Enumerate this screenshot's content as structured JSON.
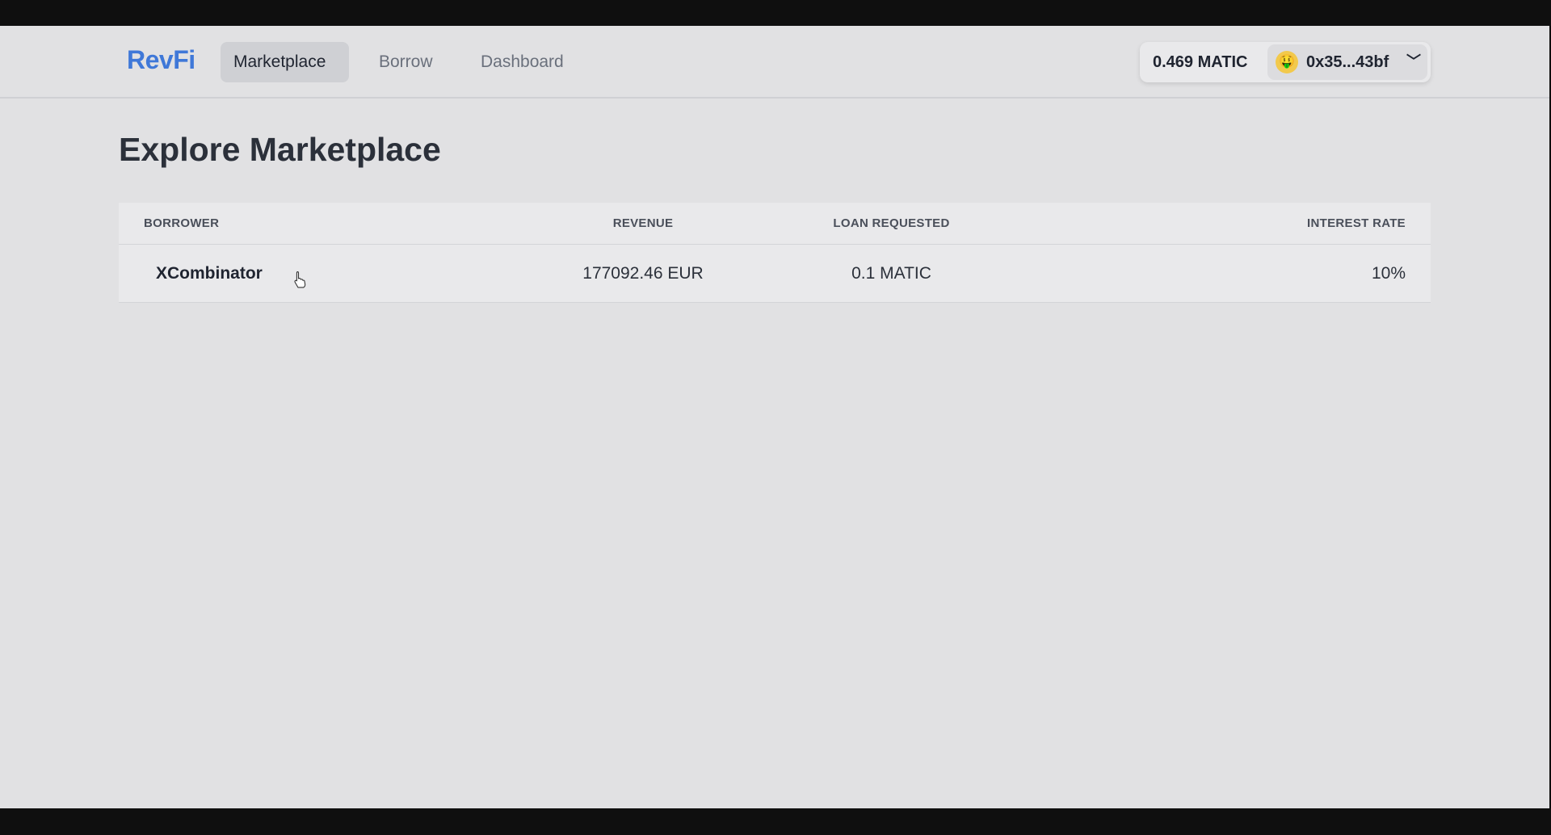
{
  "navbar": {
    "logo": "RevFi",
    "links": [
      {
        "label": "Marketplace",
        "active": true
      },
      {
        "label": "Borrow",
        "active": false
      },
      {
        "label": "Dashboard",
        "active": false
      }
    ],
    "wallet": {
      "balance": "0.469 MATIC",
      "address": "0x35...43bf",
      "avatar_emoji": "🤑",
      "chevron": "﹀"
    }
  },
  "page": {
    "title": "Explore Marketplace"
  },
  "table": {
    "columns": [
      "BORROWER",
      "REVENUE",
      "LOAN REQUESTED",
      "INTEREST RATE"
    ],
    "rows": [
      {
        "borrower": "XCombinator",
        "revenue": "177092.46 EUR",
        "loan_requested": "0.1 MATIC",
        "interest_rate": "10%"
      }
    ]
  },
  "colors": {
    "brand": "#3f78d8",
    "background": "#e1e1e3",
    "text": "#1f2430"
  }
}
